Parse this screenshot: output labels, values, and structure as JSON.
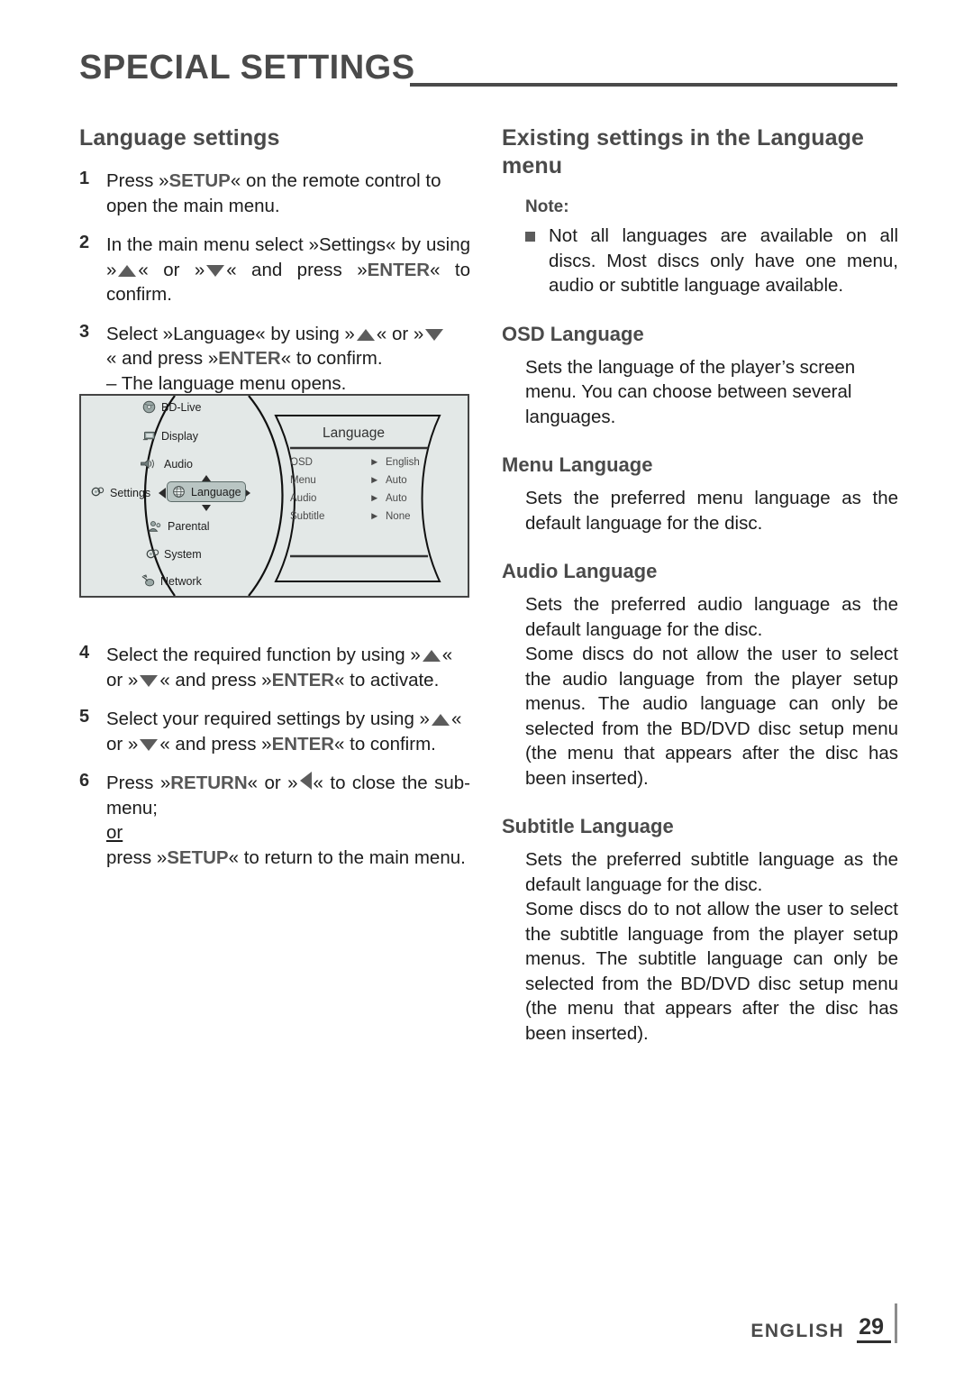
{
  "header": {
    "title": "SPECIAL SETTINGS"
  },
  "left_column": {
    "section_title": "Language settings",
    "steps": [
      {
        "num": "1",
        "parts": [
          {
            "t": "text",
            "v": "Press »"
          },
          {
            "t": "kw",
            "v": "SETUP"
          },
          {
            "t": "text",
            "v": "« on the remote control to open the main menu."
          }
        ],
        "plain": "Press »SETUP« on the remote control to open the main menu."
      },
      {
        "num": "2",
        "plain": "In the main menu select »Settings« by using » ▲ « or » ▼ « and press »ENTER« to confirm."
      },
      {
        "num": "3",
        "plain": "Select »Language« by using » ▲ « or » ▼ « and press »ENTER« to confirm.",
        "sub": "– The language menu opens."
      },
      {
        "num": "4",
        "plain": "Select the required function by using » ▲ « or » ▼ « and press »ENTER« to activate."
      },
      {
        "num": "5",
        "plain": "Select your required settings by using » ▲ « or » ▼ « and press »ENTER« to confirm."
      },
      {
        "num": "6",
        "plain": "Press »RETURN« or » ◀ « to close the sub-menu; or press »SETUP« to return to the main menu."
      }
    ],
    "words": {
      "press": "Press",
      "setup": "SETUP",
      "enter": "ENTER",
      "return": "RETURN",
      "or": "or",
      "step1_a": "Press »",
      "step1_b": "« on the remote control to open the main menu.",
      "step2_a": "In the main menu select »Settings« by using »",
      "step2_b": "« or »",
      "step2_c": "« and press »",
      "step2_d": "« to confirm.",
      "step3_a": "Select »Language« by using »",
      "step3_b": "« or »",
      "step3_c": "« and press »",
      "step3_d": "« to confirm.",
      "step3_sub": "– The language menu opens.",
      "step4_a": "Select the required function by using »",
      "step4_b": "« or »",
      "step4_c": "« and press »",
      "step4_d": "« to activate.",
      "step5_a": "Select your required settings by using »",
      "step5_b": "« or »",
      "step5_c": "« and press »",
      "step5_d": "« to confirm.",
      "step6_a": "Press »",
      "step6_b": "« or »",
      "step6_c": "« to close the sub-menu;",
      "step6_or": "or",
      "step6_d": "press »",
      "step6_e": "« to return to the main menu."
    }
  },
  "figure": {
    "name": "language-settings-menu-screen",
    "root_label": "Settings",
    "menu_items": [
      {
        "label": "BD-Live",
        "icon": "bd-live-icon",
        "selected": false
      },
      {
        "label": "Display",
        "icon": "display-icon",
        "selected": false
      },
      {
        "label": "Audio",
        "icon": "audio-icon",
        "selected": false
      },
      {
        "label": "Language",
        "icon": "language-icon",
        "selected": true
      },
      {
        "label": "Parental",
        "icon": "parental-icon",
        "selected": false
      },
      {
        "label": "System",
        "icon": "system-icon",
        "selected": false
      },
      {
        "label": "Network",
        "icon": "network-icon",
        "selected": false
      }
    ],
    "panel_title": "Language",
    "panel_rows": [
      {
        "label": "OSD",
        "value": "English"
      },
      {
        "label": "Menu",
        "value": "Auto"
      },
      {
        "label": "Audio",
        "value": "Auto"
      },
      {
        "label": "Subtitle",
        "value": "None"
      }
    ]
  },
  "right_column": {
    "section_title": "Existing settings in the Language menu",
    "note_label": "Note:",
    "note_text": "Not all languages are available on all discs. Most discs only have one menu, audio or subtitle language available.",
    "subsections": [
      {
        "title": "OSD Language",
        "paragraphs": [
          "Sets the language of the player’s screen menu. You can choose between several languages."
        ]
      },
      {
        "title": "Menu Language",
        "paragraphs": [
          "Sets the preferred menu language as the default language for the disc."
        ]
      },
      {
        "title": "Audio Language",
        "paragraphs": [
          "Sets the preferred audio language as the default language for the disc.",
          "Some discs do not allow the user to select the audio language from the player setup menus. The audio language can only be selected from the BD/DVD disc setup menu (the menu that appears after the disc has been inserted)."
        ]
      },
      {
        "title": "Subtitle Language",
        "paragraphs": [
          "Sets the preferred subtitle language as the default language for the disc.",
          "Some discs do to not allow the user to select the subtitle language from the player setup menus. The subtitle language can only be selected from the BD/DVD disc setup menu (the menu that appears after the disc has been inserted)."
        ]
      }
    ]
  },
  "footer": {
    "language": "ENGLISH",
    "page_number": "29"
  },
  "colors": {
    "heading": "#4a4a4a",
    "keyword": "#575757",
    "body": "#1c1c1c",
    "figure_bg": "#e3e8e7",
    "figure_selection": "#b9c5c3"
  }
}
